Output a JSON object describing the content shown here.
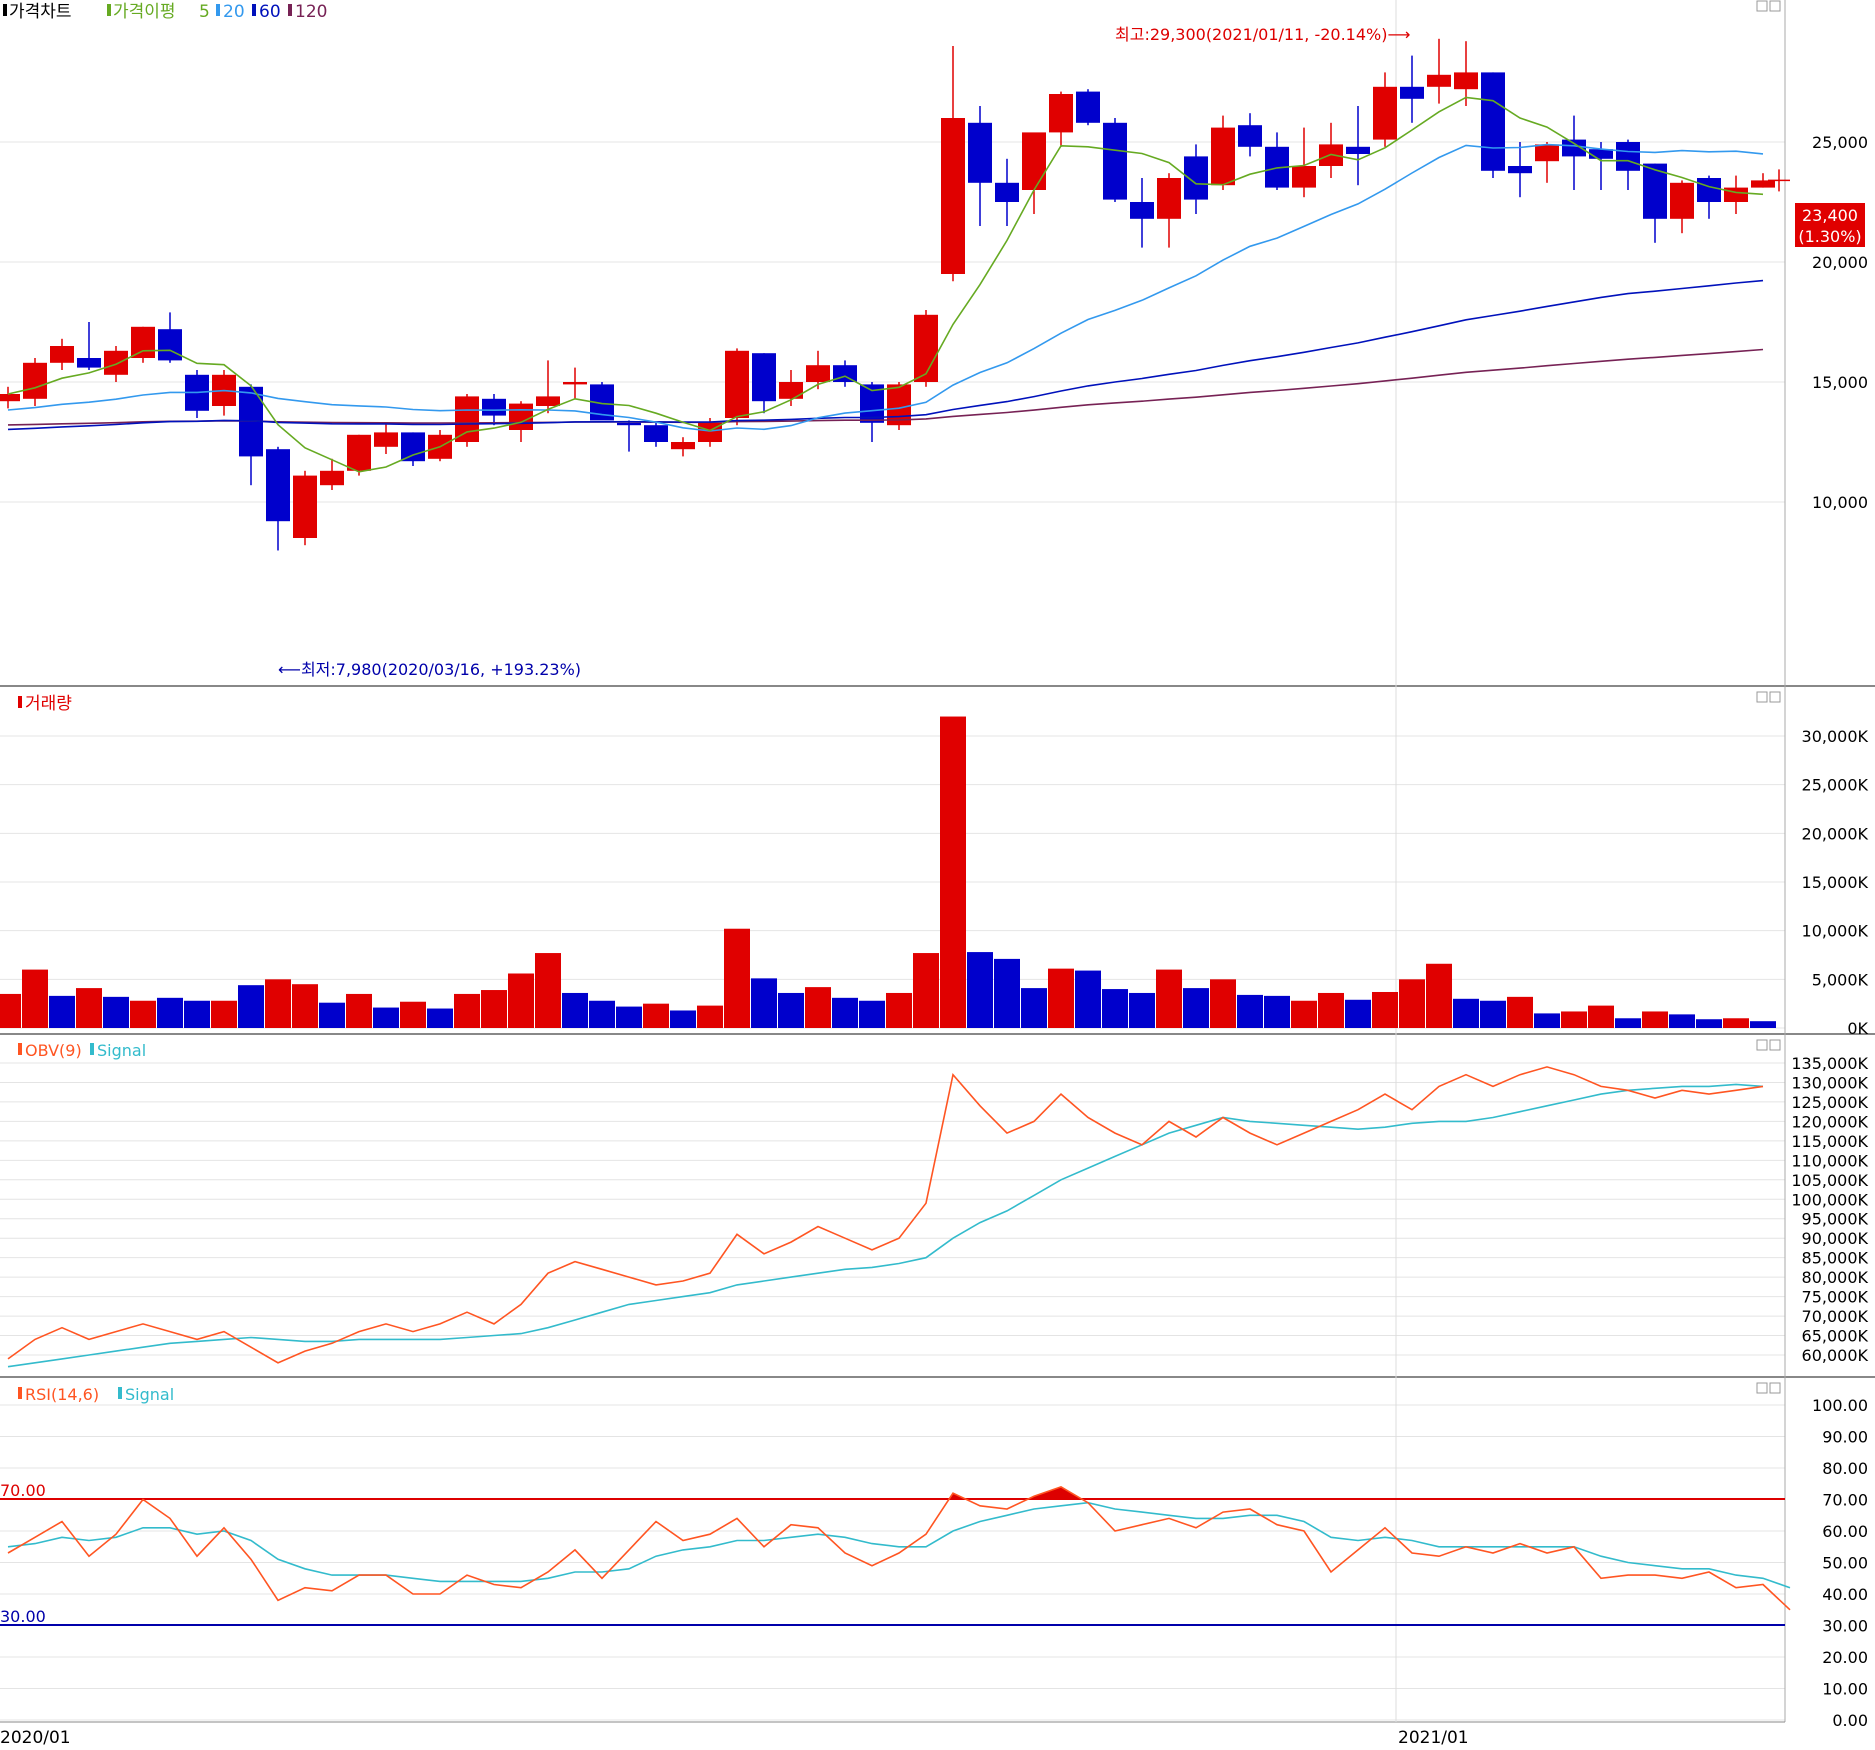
{
  "colors": {
    "up": "#e00000",
    "down": "#0000cc",
    "ma5": "#66aa22",
    "ma20": "#3399ee",
    "ma60": "#0011bb",
    "ma120": "#772255",
    "volume_up": "#e00000",
    "volume_down": "#0000cc",
    "obv": "#ff5522",
    "signal": "#33bbcc",
    "rsi": "#ff5522",
    "rsi_signal": "#33bbcc",
    "line70": "#dd0000",
    "line30": "#0000aa",
    "grid": "#e4e4e4",
    "panel_border": "#888888"
  },
  "price_panel": {
    "legend": {
      "price": "가격차트",
      "ma_label": "가격이평",
      "ma5": "5",
      "ma20": "20",
      "ma60": "60",
      "ma120": "120"
    },
    "high_annotation": "최고:29,300(2021/01/11, -20.14%)⟶",
    "low_annotation": "⟵최저:7,980(2020/03/16, +193.23%)",
    "current_price": "23,400",
    "current_change": "(1.30%)",
    "y_ticks": [
      "25,000",
      "20,000",
      "15,000",
      "10,000"
    ]
  },
  "volume_panel": {
    "legend": "거래량",
    "y_ticks": [
      "30,000K",
      "25,000K",
      "20,000K",
      "15,000K",
      "10,000K",
      "5,000K",
      "0K"
    ]
  },
  "obv_panel": {
    "legend_main": "OBV(9)",
    "legend_signal": "Signal",
    "y_ticks": [
      "135,000K",
      "130,000K",
      "125,000K",
      "120,000K",
      "115,000K",
      "110,000K",
      "105,000K",
      "100,000K",
      "95,000K",
      "90,000K",
      "85,000K",
      "80,000K",
      "75,000K",
      "70,000K",
      "65,000K",
      "60,000K"
    ]
  },
  "rsi_panel": {
    "legend_main": "RSI(14,6)",
    "legend_signal": "Signal",
    "line70_label": "70.00",
    "line30_label": "30.00",
    "y_ticks": [
      "100.00",
      "90.00",
      "80.00",
      "70.00",
      "60.00",
      "50.00",
      "40.00",
      "30.00",
      "20.00",
      "10.00",
      "0.00"
    ]
  },
  "x_axis": {
    "labels": [
      "2020/01",
      "2021/01"
    ]
  },
  "chart_data": [
    {
      "type": "candlestick",
      "title": "가격차트",
      "period": "weekly",
      "ylim": [
        7500,
        30000
      ],
      "candles": [
        {
          "o": 14200,
          "h": 14800,
          "l": 13900,
          "c": 14500
        },
        {
          "o": 14300,
          "h": 16000,
          "l": 14000,
          "c": 15800
        },
        {
          "o": 15800,
          "h": 16800,
          "l": 15500,
          "c": 16500
        },
        {
          "o": 16000,
          "h": 17500,
          "l": 15500,
          "c": 15600
        },
        {
          "o": 15300,
          "h": 16500,
          "l": 15000,
          "c": 16300
        },
        {
          "o": 16000,
          "h": 17300,
          "l": 15800,
          "c": 17300
        },
        {
          "o": 17200,
          "h": 17900,
          "l": 15800,
          "c": 15900
        },
        {
          "o": 15300,
          "h": 15500,
          "l": 13500,
          "c": 13800
        },
        {
          "o": 14000,
          "h": 15500,
          "l": 13600,
          "c": 15300
        },
        {
          "o": 14800,
          "h": 14900,
          "l": 10700,
          "c": 11900
        },
        {
          "o": 12200,
          "h": 12300,
          "l": 7980,
          "c": 9200
        },
        {
          "o": 8500,
          "h": 11300,
          "l": 8200,
          "c": 11100
        },
        {
          "o": 10700,
          "h": 11800,
          "l": 10500,
          "c": 11300
        },
        {
          "o": 11300,
          "h": 12800,
          "l": 11100,
          "c": 12800
        },
        {
          "o": 12300,
          "h": 13300,
          "l": 12000,
          "c": 12900
        },
        {
          "o": 12900,
          "h": 12900,
          "l": 11500,
          "c": 11700
        },
        {
          "o": 11800,
          "h": 13000,
          "l": 11700,
          "c": 12800
        },
        {
          "o": 12500,
          "h": 14500,
          "l": 12300,
          "c": 14400
        },
        {
          "o": 14300,
          "h": 14500,
          "l": 13200,
          "c": 13600
        },
        {
          "o": 13000,
          "h": 14200,
          "l": 12500,
          "c": 14100
        },
        {
          "o": 14000,
          "h": 15900,
          "l": 13700,
          "c": 14400
        },
        {
          "o": 14900,
          "h": 15600,
          "l": 14300,
          "c": 15000
        },
        {
          "o": 14900,
          "h": 15000,
          "l": 13500,
          "c": 13400
        },
        {
          "o": 13300,
          "h": 13400,
          "l": 12100,
          "c": 13200
        },
        {
          "o": 13200,
          "h": 13300,
          "l": 12300,
          "c": 12500
        },
        {
          "o": 12200,
          "h": 12700,
          "l": 11900,
          "c": 12500
        },
        {
          "o": 12500,
          "h": 13500,
          "l": 12300,
          "c": 13300
        },
        {
          "o": 13500,
          "h": 16400,
          "l": 13200,
          "c": 16300
        },
        {
          "o": 16200,
          "h": 16200,
          "l": 13700,
          "c": 14200
        },
        {
          "o": 14300,
          "h": 15500,
          "l": 14000,
          "c": 15000
        },
        {
          "o": 15000,
          "h": 16300,
          "l": 14700,
          "c": 15700
        },
        {
          "o": 15700,
          "h": 15900,
          "l": 14800,
          "c": 15000
        },
        {
          "o": 14900,
          "h": 15000,
          "l": 12500,
          "c": 13300
        },
        {
          "o": 13200,
          "h": 15000,
          "l": 13000,
          "c": 14900
        },
        {
          "o": 15000,
          "h": 18000,
          "l": 14800,
          "c": 17800
        },
        {
          "o": 19500,
          "h": 29000,
          "l": 19200,
          "c": 26000
        },
        {
          "o": 25800,
          "h": 26500,
          "l": 21500,
          "c": 23300
        },
        {
          "o": 23300,
          "h": 24300,
          "l": 21500,
          "c": 22500
        },
        {
          "o": 23000,
          "h": 25300,
          "l": 22000,
          "c": 25400
        },
        {
          "o": 25400,
          "h": 27100,
          "l": 24800,
          "c": 27000
        },
        {
          "o": 27100,
          "h": 27200,
          "l": 25700,
          "c": 25800
        },
        {
          "o": 25800,
          "h": 26000,
          "l": 22500,
          "c": 22600
        },
        {
          "o": 22500,
          "h": 23500,
          "l": 20600,
          "c": 21800
        },
        {
          "o": 21800,
          "h": 23700,
          "l": 20600,
          "c": 23500
        },
        {
          "o": 24400,
          "h": 24900,
          "l": 22000,
          "c": 22600
        },
        {
          "o": 23200,
          "h": 26100,
          "l": 23000,
          "c": 25600
        },
        {
          "o": 25700,
          "h": 26200,
          "l": 24400,
          "c": 24800
        },
        {
          "o": 24800,
          "h": 25400,
          "l": 23000,
          "c": 23100
        },
        {
          "o": 23100,
          "h": 25600,
          "l": 22700,
          "c": 24000
        },
        {
          "o": 24000,
          "h": 25800,
          "l": 23500,
          "c": 24900
        },
        {
          "o": 24800,
          "h": 26500,
          "l": 23200,
          "c": 24500
        },
        {
          "o": 25100,
          "h": 27900,
          "l": 24800,
          "c": 27300
        },
        {
          "o": 27300,
          "h": 28600,
          "l": 25800,
          "c": 26800
        },
        {
          "o": 27300,
          "h": 29300,
          "l": 26600,
          "c": 27800
        },
        {
          "o": 27200,
          "h": 29200,
          "l": 26500,
          "c": 27900
        },
        {
          "o": 27900,
          "h": 27900,
          "l": 23500,
          "c": 23800
        },
        {
          "o": 24000,
          "h": 25000,
          "l": 22700,
          "c": 23700
        },
        {
          "o": 24200,
          "h": 25000,
          "l": 23300,
          "c": 24900
        },
        {
          "o": 25100,
          "h": 26100,
          "l": 23000,
          "c": 24400
        },
        {
          "o": 24700,
          "h": 25000,
          "l": 23000,
          "c": 24300
        },
        {
          "o": 25000,
          "h": 25100,
          "l": 23000,
          "c": 23800
        },
        {
          "o": 24100,
          "h": 24100,
          "l": 20800,
          "c": 21800
        },
        {
          "o": 21800,
          "h": 23400,
          "l": 21200,
          "c": 23300
        },
        {
          "o": 23500,
          "h": 23600,
          "l": 21800,
          "c": 22500
        },
        {
          "o": 22500,
          "h": 23600,
          "l": 22000,
          "c": 23100
        },
        {
          "o": 23100,
          "h": 23700,
          "l": 23100,
          "c": 23400
        }
      ]
    },
    {
      "type": "bar",
      "title": "거래량",
      "unit": "K",
      "ylim": [
        0,
        32000
      ],
      "values": [
        3500,
        6000,
        3300,
        4100,
        3200,
        2800,
        3100,
        2800,
        2800,
        4400,
        5000,
        4500,
        2600,
        3500,
        2100,
        2700,
        2000,
        3500,
        3900,
        5600,
        7700,
        3600,
        2800,
        2200,
        2500,
        1800,
        2300,
        10200,
        5100,
        3600,
        4200,
        3100,
        2800,
        3600,
        7700,
        32000,
        7800,
        7100,
        4100,
        6100,
        5900,
        4000,
        3600,
        6000,
        4100,
        5000,
        3400,
        3300,
        2800,
        3600,
        2900,
        3700,
        5000,
        6600,
        3000,
        2800,
        3200,
        1500,
        1700,
        2300,
        1000,
        1700,
        1400,
        900,
        1000,
        700
      ],
      "up_flags": [
        1,
        1,
        0,
        1,
        0,
        1,
        0,
        0,
        1,
        0,
        1,
        1,
        0,
        1,
        0,
        1,
        0,
        1,
        1,
        1,
        1,
        0,
        0,
        0,
        1,
        0,
        1,
        1,
        0,
        0,
        1,
        0,
        0,
        1,
        1,
        1,
        0,
        0,
        0,
        1,
        0,
        0,
        0,
        1,
        0,
        1,
        0,
        0,
        1,
        1,
        0,
        1,
        1,
        1,
        0,
        0,
        1,
        0,
        1,
        1,
        0,
        1,
        0,
        0,
        1,
        0
      ]
    },
    {
      "type": "line",
      "title": "OBV(9)",
      "unit": "K",
      "ylim": [
        57000,
        138000
      ],
      "series": [
        {
          "name": "OBV(9)",
          "values": [
            59000,
            64000,
            67000,
            64000,
            66000,
            68000,
            66000,
            64000,
            66000,
            62000,
            58000,
            61000,
            63000,
            66000,
            68000,
            66000,
            68000,
            71000,
            68000,
            73000,
            81000,
            84000,
            82000,
            80000,
            78000,
            79000,
            81000,
            91000,
            86000,
            89000,
            93000,
            90000,
            87000,
            90000,
            99000,
            132000,
            124000,
            117000,
            120000,
            127000,
            121000,
            117000,
            114000,
            120000,
            116000,
            121000,
            117000,
            114000,
            117000,
            120000,
            123000,
            127000,
            123000,
            129000,
            132000,
            129000,
            132000,
            134000,
            132000,
            129000,
            128000,
            126000,
            128000,
            127000,
            128000,
            129000
          ]
        },
        {
          "name": "Signal",
          "values": [
            57000,
            58000,
            59000,
            60000,
            61000,
            62000,
            63000,
            63500,
            64000,
            64500,
            64000,
            63500,
            63500,
            64000,
            64000,
            64000,
            64000,
            64500,
            65000,
            65500,
            67000,
            69000,
            71000,
            73000,
            74000,
            75000,
            76000,
            78000,
            79000,
            80000,
            81000,
            82000,
            82500,
            83500,
            85000,
            90000,
            94000,
            97000,
            101000,
            105000,
            108000,
            111000,
            114000,
            117000,
            119000,
            121000,
            120000,
            119500,
            119000,
            118500,
            118000,
            118500,
            119500,
            120000,
            120000,
            121000,
            122500,
            124000,
            125500,
            127000,
            128000,
            128500,
            129000,
            129000,
            129500,
            129000
          ]
        }
      ]
    },
    {
      "type": "line",
      "title": "RSI(14,6)",
      "ylim": [
        0,
        100
      ],
      "reference_lines": [
        70,
        30
      ],
      "series": [
        {
          "name": "RSI(14,6)",
          "values": [
            53,
            58,
            63,
            52,
            59,
            70,
            64,
            52,
            61,
            51,
            38,
            42,
            41,
            46,
            46,
            40,
            40,
            46,
            43,
            42,
            47,
            54,
            45,
            54,
            63,
            57,
            59,
            64,
            55,
            62,
            61,
            53,
            49,
            53,
            59,
            72,
            68,
            67,
            71,
            74,
            69,
            60,
            62,
            64,
            61,
            66,
            67,
            62,
            60,
            47,
            54,
            61,
            53,
            52,
            55,
            53,
            56,
            53,
            55,
            45,
            46,
            46,
            45,
            47,
            42,
            43,
            35
          ]
        },
        {
          "name": "Signal",
          "values": [
            55,
            56,
            58,
            57,
            58,
            61,
            61,
            59,
            60,
            57,
            51,
            48,
            46,
            46,
            46,
            45,
            44,
            44,
            44,
            44,
            45,
            47,
            47,
            48,
            52,
            54,
            55,
            57,
            57,
            58,
            59,
            58,
            56,
            55,
            55,
            60,
            63,
            65,
            67,
            68,
            69,
            67,
            66,
            65,
            64,
            64,
            65,
            65,
            63,
            58,
            57,
            58,
            57,
            55,
            55,
            55,
            55,
            55,
            55,
            52,
            50,
            49,
            48,
            48,
            46,
            45,
            42
          ]
        }
      ]
    }
  ]
}
